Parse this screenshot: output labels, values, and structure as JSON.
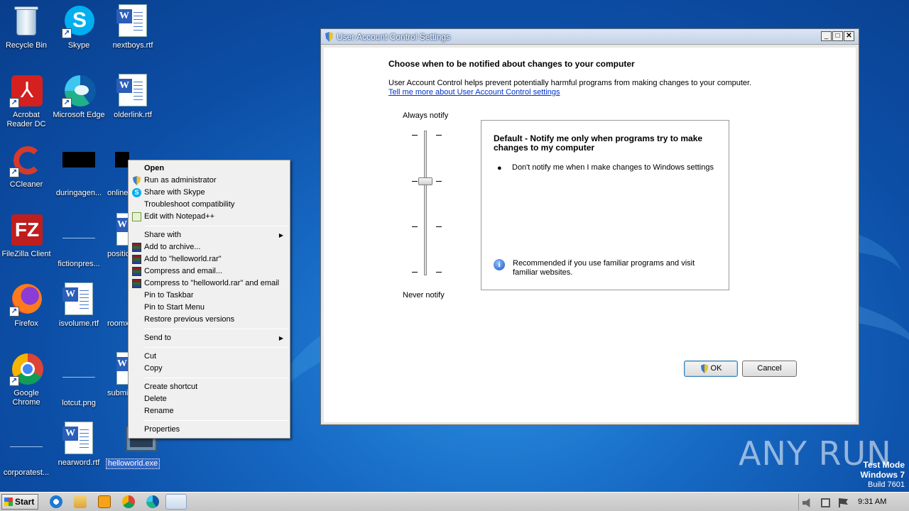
{
  "desktop": {
    "icons": [
      {
        "label": "Recycle Bin"
      },
      {
        "label": "Skype"
      },
      {
        "label": "nextboys.rtf"
      },
      {
        "label": "Acrobat Reader DC"
      },
      {
        "label": "Microsoft Edge"
      },
      {
        "label": "olderlink.rtf"
      },
      {
        "label": "CCleaner"
      },
      {
        "label": "duringagen..."
      },
      {
        "label": "online"
      },
      {
        "label": "FileZilla Client"
      },
      {
        "label": "fictionpres..."
      },
      {
        "label": "positio"
      },
      {
        "label": "Firefox"
      },
      {
        "label": "isvolume.rtf"
      },
      {
        "label": "roomx"
      },
      {
        "label": "Google Chrome"
      },
      {
        "label": "lotcut.png"
      },
      {
        "label": "submi"
      },
      {
        "label": "corporatest..."
      },
      {
        "label": "nearword.rtf"
      },
      {
        "label": "helloworld.exe"
      }
    ]
  },
  "context_menu": {
    "items": [
      {
        "label": "Open"
      },
      {
        "label": "Run as administrator"
      },
      {
        "label": "Share with Skype"
      },
      {
        "label": "Troubleshoot compatibility"
      },
      {
        "label": "Edit with Notepad++"
      },
      {
        "label": "Share with"
      },
      {
        "label": "Add to archive..."
      },
      {
        "label": "Add to \"helloworld.rar\""
      },
      {
        "label": "Compress and email..."
      },
      {
        "label": "Compress to \"helloworld.rar\" and email"
      },
      {
        "label": "Pin to Taskbar"
      },
      {
        "label": "Pin to Start Menu"
      },
      {
        "label": "Restore previous versions"
      },
      {
        "label": "Send to"
      },
      {
        "label": "Cut"
      },
      {
        "label": "Copy"
      },
      {
        "label": "Create shortcut"
      },
      {
        "label": "Delete"
      },
      {
        "label": "Rename"
      },
      {
        "label": "Properties"
      }
    ]
  },
  "uac_window": {
    "title": "User Account Control Settings",
    "heading": "Choose when to be notified about changes to your computer",
    "description": "User Account Control helps prevent potentially harmful programs from making changes to your computer.",
    "link": "Tell me more about User Account Control settings",
    "slider_top_label": "Always notify",
    "slider_bottom_label": "Never notify",
    "slider_level": "2 of 4",
    "info_title": "Default - Notify me only when programs try to make changes to my computer",
    "info_bullet": "Don't notify me when I make changes to Windows settings",
    "info_recommend": "Recommended if you use familiar programs and visit familiar websites.",
    "ok_label": "OK",
    "cancel_label": "Cancel"
  },
  "taskbar": {
    "start_label": "Start",
    "clock": "9:31 AM"
  },
  "watermark": {
    "brand": "ANY RUN",
    "mode": "Test Mode",
    "os": "Windows 7",
    "build": "Build 7601"
  }
}
